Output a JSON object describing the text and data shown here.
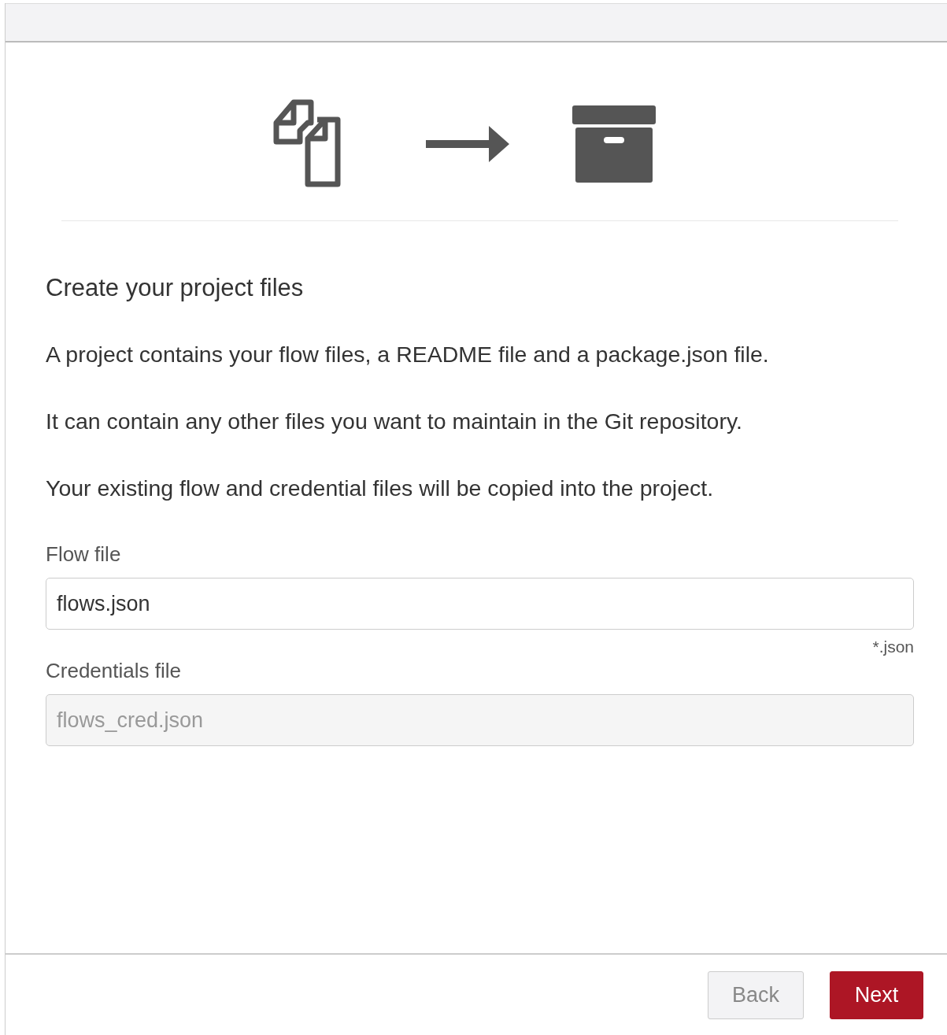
{
  "heading": "Create your project files",
  "paragraphs": [
    "A project contains your flow files, a README file and a package.json file.",
    "It can contain any other files you want to maintain in the Git repository.",
    "Your existing flow and credential files will be copied into the project."
  ],
  "fields": [
    {
      "label": "Flow file",
      "value": "flows.json",
      "hint": "*.json",
      "disabled": false
    },
    {
      "label": "Credentials file",
      "value": "flows_cred.json",
      "disabled": true
    }
  ],
  "buttons": [
    {
      "label": "Back",
      "kind": "secondary"
    },
    {
      "label": "Next",
      "kind": "primary"
    }
  ]
}
